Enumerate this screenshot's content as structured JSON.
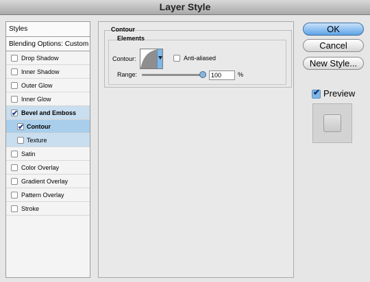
{
  "window": {
    "title": "Layer Style"
  },
  "styles_panel": {
    "header": "Styles",
    "blending": "Blending Options: Custom",
    "items": [
      {
        "label": "Drop Shadow",
        "checked": false
      },
      {
        "label": "Inner Shadow",
        "checked": false
      },
      {
        "label": "Outer Glow",
        "checked": false
      },
      {
        "label": "Inner Glow",
        "checked": false
      },
      {
        "label": "Bevel and Emboss",
        "checked": true
      },
      {
        "label": "Contour",
        "checked": true
      },
      {
        "label": "Texture",
        "checked": false
      },
      {
        "label": "Satin",
        "checked": false
      },
      {
        "label": "Color Overlay",
        "checked": false
      },
      {
        "label": "Gradient Overlay",
        "checked": false
      },
      {
        "label": "Pattern Overlay",
        "checked": false
      },
      {
        "label": "Stroke",
        "checked": false
      }
    ]
  },
  "contour_panel": {
    "section_title": "Contour",
    "group_title": "Elements",
    "contour_label": "Contour:",
    "anti_aliased_label": "Anti-aliased",
    "anti_aliased_checked": false,
    "range_label": "Range:",
    "range_value": "100",
    "range_unit": "%"
  },
  "buttons": {
    "ok": "OK",
    "cancel": "Cancel",
    "new_style": "New Style..."
  },
  "preview": {
    "label": "Preview",
    "checked": true
  },
  "colors": {
    "accent": "#5ea3e6",
    "selected_row": "#a9ceec",
    "highlight_row": "#c9deef"
  }
}
